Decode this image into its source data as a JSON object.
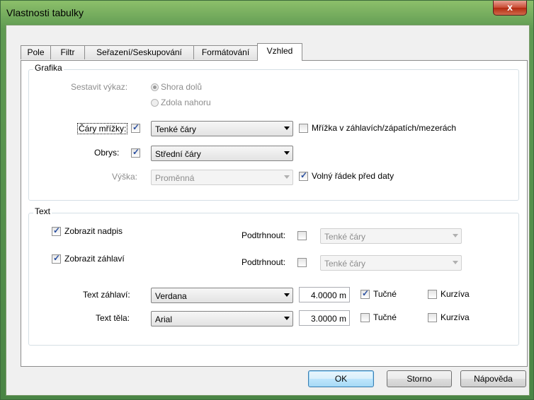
{
  "window": {
    "title": "Vlastnosti tabulky",
    "close_glyph": "x"
  },
  "tabs": [
    {
      "label": "Pole"
    },
    {
      "label": "Filtr"
    },
    {
      "label": "Seřazení/Seskupování"
    },
    {
      "label": "Formátování"
    },
    {
      "label": "Vzhled"
    }
  ],
  "active_tab": "Vzhled",
  "grafika": {
    "legend": "Grafika",
    "sestavit_label": "Sestavit výkaz:",
    "radio_shora": "Shora dolů",
    "radio_zdola": "Zdola nahoru",
    "cary_label": "Čáry mřížky:",
    "cary_value": "Tenké čáry",
    "mrizka_label": "Mřížka v záhlavích/zápatích/mezerách",
    "obrys_label": "Obrys:",
    "obrys_value": "Střední čáry",
    "vyska_label": "Výška:",
    "vyska_value": "Proměnná",
    "volny_label": "Volný řádek před daty"
  },
  "text": {
    "legend": "Text",
    "zobrazit_nadpis": "Zobrazit nadpis",
    "zobrazit_zahlavi": "Zobrazit záhlaví",
    "podtrhnout1_label": "Podtrhnout:",
    "podtrhnout1_value": "Tenké čáry",
    "podtrhnout2_label": "Podtrhnout:",
    "podtrhnout2_value": "Tenké čáry",
    "text_zahlavi_label": "Text záhlaví:",
    "text_zahlavi_font": "Verdana",
    "text_zahlavi_size": "4.0000 m",
    "text_zahlavi_tucne": "Tučné",
    "text_zahlavi_kurziva": "Kurzíva",
    "text_tela_label": "Text těla:",
    "text_tela_font": "Arial",
    "text_tela_size": "3.0000 m",
    "text_tela_tucne": "Tučné",
    "text_tela_kurziva": "Kurzíva"
  },
  "buttons": {
    "ok": "OK",
    "storno": "Storno",
    "napoveda": "Nápověda"
  },
  "states": {
    "radio_shora": true,
    "radio_zdola": false,
    "cary_mrizky": true,
    "mrizka": false,
    "obrys": true,
    "volny_radek": true,
    "zobrazit_nadpis": true,
    "zobrazit_zahlavi": true,
    "podtrhnout1": false,
    "podtrhnout2": false,
    "zahlavi_tucne": true,
    "zahlavi_kurziva": false,
    "tela_tucne": false,
    "tela_kurziva": false
  }
}
